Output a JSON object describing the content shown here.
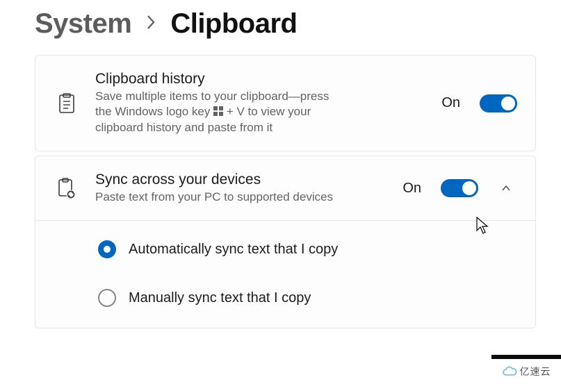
{
  "breadcrumb": {
    "parent": "System",
    "current": "Clipboard"
  },
  "accent_color": "#0067c0",
  "rows": {
    "history": {
      "title": "Clipboard history",
      "desc_pre": "Save multiple items to your clipboard—press the Windows logo key ",
      "desc_post": " + V to view your clipboard history and paste from it",
      "state": "On"
    },
    "sync": {
      "title": "Sync across your devices",
      "desc": "Paste text from your PC to supported devices",
      "state": "On"
    }
  },
  "sync_options": {
    "auto": "Automatically sync text that I copy",
    "manual": "Manually sync text that I copy"
  },
  "watermark": "亿速云"
}
